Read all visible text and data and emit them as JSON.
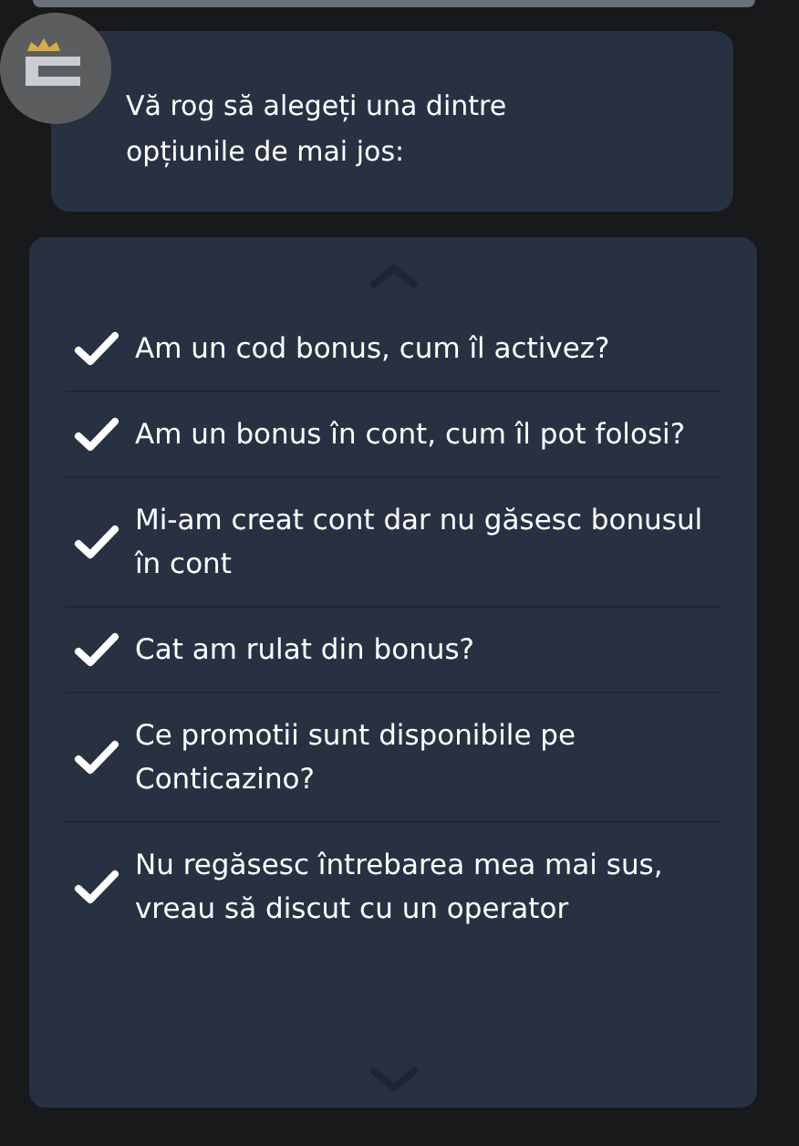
{
  "message": {
    "text": "Vă rog să alegeți una dintre opțiunile de mai jos:"
  },
  "options": [
    {
      "label": "Am un cod bonus, cum îl activez?"
    },
    {
      "label": "Am un bonus în cont, cum îl pot folosi?"
    },
    {
      "label": "Mi-am creat cont dar nu găsesc bonusul în cont"
    },
    {
      "label": "Cat am rulat din bonus?"
    },
    {
      "label": "Ce promotii sunt disponibile pe Conticazino?"
    },
    {
      "label": "Nu regăsesc întrebarea mea mai sus, vreau să discut cu un operator"
    }
  ]
}
